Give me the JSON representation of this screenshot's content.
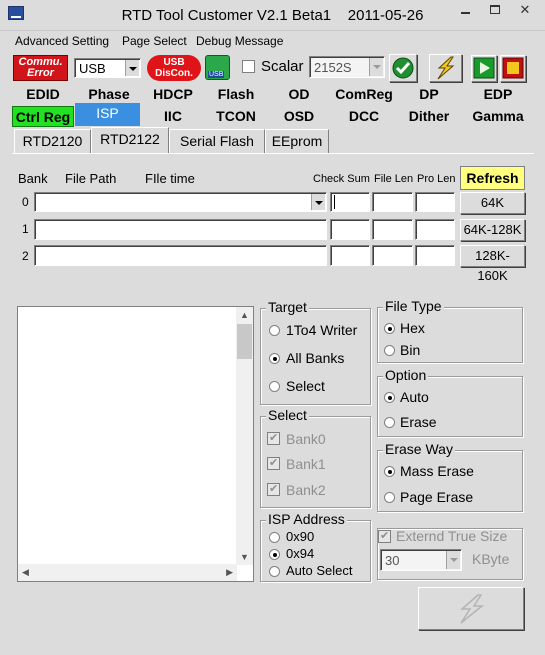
{
  "window": {
    "title": "RTD Tool Customer V2.1 Beta1    2011-05-26",
    "min_icon": "minimize-icon",
    "close_glyph": "✕"
  },
  "menu": {
    "items": [
      "Advanced Setting",
      "Page Select",
      "Debug Message"
    ]
  },
  "toolbar": {
    "commu_line1": "Commu.",
    "commu_line2": "Error",
    "port_value": "USB",
    "usb_line1": "USB",
    "usb_line2": "DisCon.",
    "usb_icon_label": "USB",
    "scalar_label": "Scalar",
    "scalar_value": "2152S",
    "colors": {
      "commu_red": "#d0141a",
      "usb_red": "#e01418",
      "play_green": "#1a9a2a",
      "stop_yellow": "#f2c81c",
      "isp_tab_blue": "#3b8fe0",
      "ctrl_green": "#22e022",
      "refresh_yellow": "#ffff80"
    }
  },
  "nav": {
    "row1": [
      "EDID",
      "Phase",
      "HDCP",
      "Flash",
      "OD",
      "ComReg",
      "DP",
      "EDP"
    ],
    "row2": [
      "Ctrl Reg",
      "ISP",
      "IIC",
      "TCON",
      "OSD",
      "DCC",
      "Dither",
      "Gamma"
    ],
    "active": "ISP"
  },
  "subtabs": [
    "RTD2120",
    "RTD2122",
    "Serial Flash",
    "EEprom"
  ],
  "subtab_active": "RTD2122",
  "bank_table": {
    "headers": {
      "bank": "Bank",
      "file_path": "File Path",
      "file_time": "FIle time",
      "check_sum": "Check Sum",
      "file_len": "File Len",
      "pro_len": "Pro Len"
    },
    "rows": [
      "0",
      "1",
      "2"
    ],
    "refresh_label": "Refresh",
    "range_buttons": [
      "64K",
      "64K-128K",
      "128K-160K"
    ]
  },
  "target": {
    "title": "Target",
    "options": [
      "1To4 Writer",
      "All Banks",
      "Select"
    ],
    "selected": "All Banks"
  },
  "select": {
    "title": "Select",
    "banks": [
      "Bank0",
      "Bank1",
      "Bank2"
    ]
  },
  "isp_address": {
    "title": "ISP Address",
    "options": [
      "0x90",
      "0x94",
      "Auto Select"
    ],
    "selected": "0x94"
  },
  "file_type": {
    "title": "File Type",
    "options": [
      "Hex",
      "Bin"
    ],
    "selected": "Hex"
  },
  "option": {
    "title": "Option",
    "options": [
      "Auto",
      "Erase"
    ],
    "selected": "Auto"
  },
  "erase_way": {
    "title": "Erase Way",
    "options": [
      "Mass Erase",
      "Page Erase"
    ],
    "selected": "Mass Erase"
  },
  "extend": {
    "label": "Externd True Size",
    "value": "30",
    "unit": "KByte"
  }
}
